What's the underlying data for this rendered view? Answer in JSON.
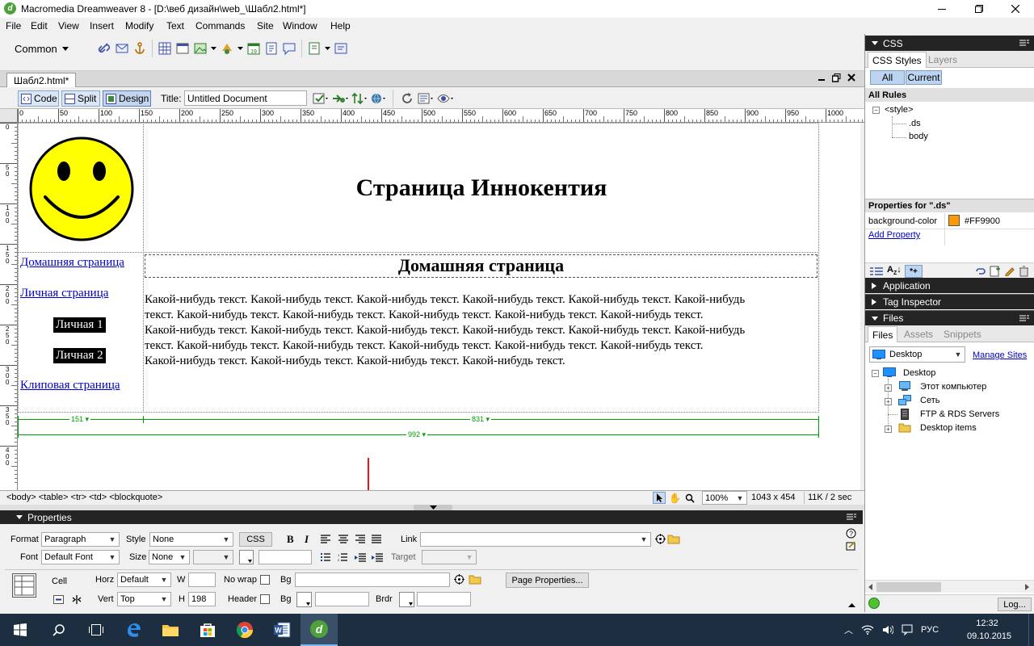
{
  "window": {
    "title": "Macromedia Dreamweaver 8 - [D:\\веб дизайн\\web_\\Шабл2.html*]"
  },
  "menu": [
    "File",
    "Edit",
    "View",
    "Insert",
    "Modify",
    "Text",
    "Commands",
    "Site",
    "Window",
    "Help"
  ],
  "insert_bar": {
    "category": "Common"
  },
  "document": {
    "tab": "Шабл2.html*",
    "views": {
      "code": "Code",
      "split": "Split",
      "design": "Design"
    },
    "title_label": "Title:",
    "title_value": "Untitled Document"
  },
  "ruler": [
    "0",
    "50",
    "100",
    "150",
    "200",
    "250",
    "300",
    "350",
    "400",
    "450",
    "500",
    "550",
    "600",
    "650",
    "700",
    "750",
    "800",
    "850",
    "900",
    "950",
    "1000"
  ],
  "vruler": [
    "0",
    "50",
    "100",
    "150",
    "200",
    "250",
    "300",
    "350",
    "400"
  ],
  "page": {
    "heading": "Страница Иннокентия",
    "nav": [
      "Домашняя страница",
      "Личная страница",
      "Личная 1",
      "Личная 2",
      "Клиповая страница"
    ],
    "section_title": "Домашняя страница",
    "body_lines": [
      "Какой-нибудь текст. Какой-нибудь текст. Какой-нибудь текст. Какой-нибудь текст. Какой-нибудь текст. Какой-нибудь",
      "текст. Какой-нибудь текст. Какой-нибудь текст. Какой-нибудь текст. Какой-нибудь текст. Какой-нибудь текст.",
      "Какой-нибудь текст. Какой-нибудь текст. Какой-нибудь текст. Какой-нибудь текст. Какой-нибудь текст. Какой-нибудь",
      "текст. Какой-нибудь текст. Какой-нибудь текст. Какой-нибудь текст. Какой-нибудь текст. Какой-нибудь текст.",
      "Какой-нибудь текст. Какой-нибудь текст. Какой-нибудь текст. Какой-нибудь текст."
    ],
    "width_marks": {
      "col1": "151",
      "col2": "831",
      "total": "992"
    }
  },
  "statusbar": {
    "tags": "<body> <table> <tr> <td> <blockquote>",
    "zoom": "100%",
    "size": "1043 x 454",
    "weight": "11K / 2 sec"
  },
  "properties": {
    "header": "Properties",
    "format_label": "Format",
    "format_value": "Paragraph",
    "style_label": "Style",
    "style_value": "None",
    "css_button": "CSS",
    "bold": "B",
    "italic": "I",
    "link_label": "Link",
    "link_value": "",
    "font_label": "Font",
    "font_value": "Default Font",
    "size_label": "Size",
    "size_value": "None",
    "target_label": "Target",
    "cell_label": "Cell",
    "horz_label": "Horz",
    "horz_value": "Default",
    "w_label": "W",
    "w_value": "",
    "nowrap_label": "No wrap",
    "bg_label": "Bg",
    "bg_value": "",
    "page_props_button": "Page Properties...",
    "vert_label": "Vert",
    "vert_value": "Top",
    "h_label": "H",
    "h_value": "198",
    "header_label": "Header",
    "bg2_label": "Bg",
    "brdr_label": "Brdr"
  },
  "css_panel": {
    "header": "CSS",
    "tabs": [
      "CSS Styles",
      "Layers"
    ],
    "modes": [
      "All",
      "Current"
    ],
    "all_rules": "All Rules",
    "rules": [
      "<style>",
      ".ds",
      "body"
    ],
    "props_for": "Properties for \".ds\"",
    "prop_name": "background-color",
    "prop_value": "#FF9900",
    "prop_color": "#FF9900",
    "add_property": "Add Property"
  },
  "panels": {
    "application": "Application",
    "tag_inspector": "Tag Inspector",
    "files": "Files"
  },
  "files_panel": {
    "tabs": [
      "Files",
      "Assets",
      "Snippets"
    ],
    "site": "Desktop",
    "manage": "Manage Sites",
    "tree": [
      "Desktop",
      "Этот компьютер",
      "Сеть",
      "FTP & RDS Servers",
      "Desktop items"
    ],
    "log_button": "Log..."
  },
  "taskbar": {
    "lang": "РУС",
    "time": "12:32",
    "date": "09.10.2015"
  },
  "colors": {
    "accent": "#0078d7",
    "title_bg": "#ffffff",
    "dark_panel": "#242424",
    "annotation": "#e8141c",
    "grid_green": "#00a000"
  }
}
